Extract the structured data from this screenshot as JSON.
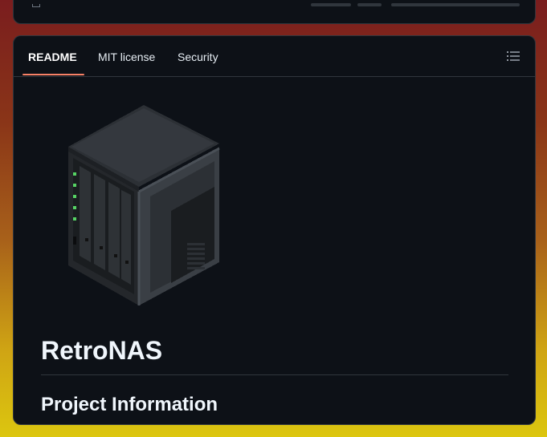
{
  "tabs": [
    {
      "label": "README",
      "active": true
    },
    {
      "label": "MIT license",
      "active": false
    },
    {
      "label": "Security",
      "active": false
    }
  ],
  "outline_icon": "list-unordered-icon",
  "readme": {
    "logo": "retronas-nas-pixel-logo",
    "title": "RetroNAS",
    "section_heading": "Project Information"
  },
  "colors": {
    "background": "#0d1117",
    "border": "#30363d",
    "active_tab_underline": "#f78166",
    "text": "#e6edf3",
    "led_green": "#56d364"
  }
}
